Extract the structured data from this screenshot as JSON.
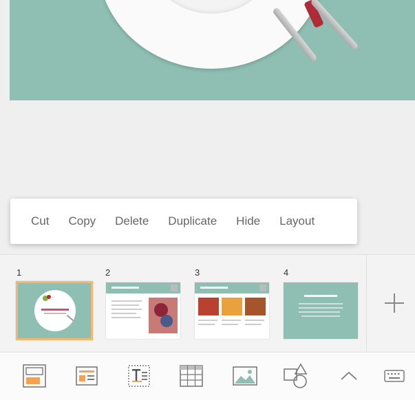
{
  "context_menu": {
    "items": [
      "Cut",
      "Copy",
      "Delete",
      "Duplicate",
      "Hide",
      "Layout"
    ]
  },
  "slides": {
    "numbers": [
      "1",
      "2",
      "3",
      "4"
    ],
    "selected_index": 1
  },
  "toolbar": {
    "icons": [
      "slide-layout-icon",
      "template-icon",
      "text-box-icon",
      "table-icon",
      "image-icon",
      "shapes-icon",
      "chevron-up-icon",
      "keyboard-icon"
    ]
  },
  "colors": {
    "accent_teal": "#8fbfb3",
    "selection_border": "#f0b870",
    "icon_orange": "#f5a24b",
    "icon_gray": "#7a7a7a"
  }
}
